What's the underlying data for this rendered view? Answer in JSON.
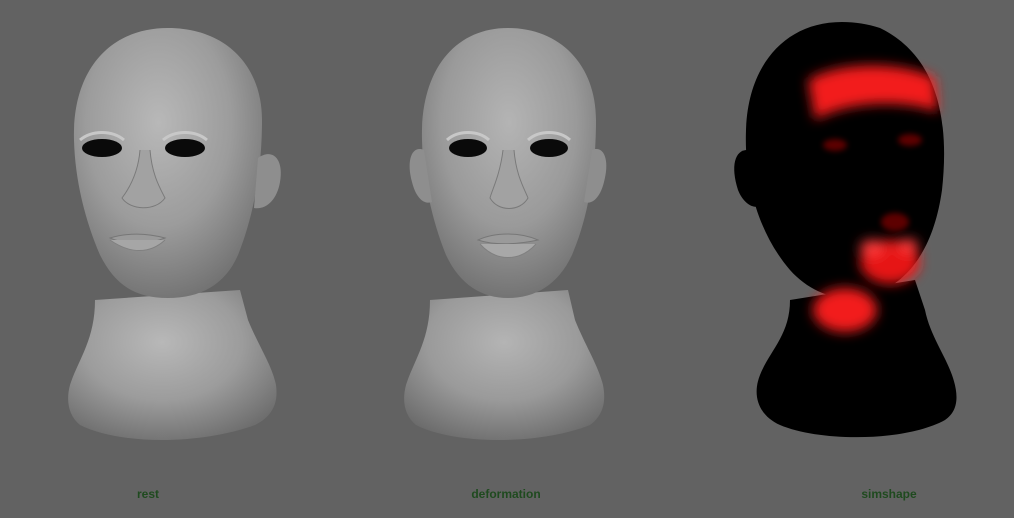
{
  "viewport": {
    "background": "#626262",
    "label_color": "#1f4a1f",
    "highlight_color": "#ff1a1a"
  },
  "models": [
    {
      "label": "rest",
      "shading": "gray"
    },
    {
      "label": "deformation",
      "shading": "gray"
    },
    {
      "label": "simshape",
      "shading": "heatmap"
    }
  ]
}
